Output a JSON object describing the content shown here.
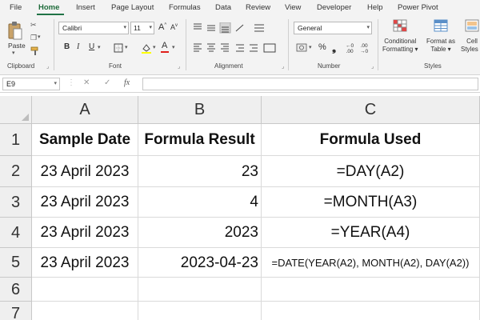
{
  "ribbon_tabs": [
    "File",
    "Home",
    "Insert",
    "Page Layout",
    "Formulas",
    "Data",
    "Review",
    "View",
    "Developer",
    "Help",
    "Power Pivot"
  ],
  "active_tab": "Home",
  "clipboard": {
    "paste_label": "Paste",
    "group_label": "Clipboard"
  },
  "font": {
    "name": "Calibri",
    "size": "11",
    "bold": "B",
    "italic": "I",
    "underline": "U",
    "grow": "A",
    "shrink": "A",
    "color_letter": "A",
    "group_label": "Font"
  },
  "alignment": {
    "group_label": "Alignment"
  },
  "number": {
    "format": "General",
    "percent": "%",
    "group_label": "Number"
  },
  "styles": {
    "conditional_line1": "Conditional",
    "conditional_line2": "Formatting",
    "format_table_line1": "Format as",
    "format_table_line2": "Table",
    "cell_styles_line1": "Cell",
    "cell_styles_line2": "Styles",
    "group_label": "Styles"
  },
  "formula_bar": {
    "name_box": "E9",
    "fx": "fx",
    "cancel": "✕",
    "enter": "✓",
    "content": ""
  },
  "columns": [
    "A",
    "B",
    "C"
  ],
  "rows": [
    {
      "num": "1",
      "a": "Sample Date",
      "b": "Formula Result",
      "c": "Formula Used"
    },
    {
      "num": "2",
      "a": "23 April 2023",
      "b": "23",
      "c": "=DAY(A2)"
    },
    {
      "num": "3",
      "a": "23 April 2023",
      "b": "4",
      "c": "=MONTH(A3)"
    },
    {
      "num": "4",
      "a": "23 April 2023",
      "b": "2023",
      "c": "=YEAR(A4)"
    },
    {
      "num": "5",
      "a": "23 April 2023",
      "b": "2023-04-23",
      "c": "=DATE(YEAR(A2), MONTH(A2), DAY(A2))"
    },
    {
      "num": "6",
      "a": "",
      "b": "",
      "c": ""
    },
    {
      "num": "7",
      "a": "",
      "b": "",
      "c": ""
    }
  ],
  "colors": {
    "accent": "#217346",
    "header_bg": "#efefef",
    "ribbon_bg": "#f3f3f3"
  }
}
